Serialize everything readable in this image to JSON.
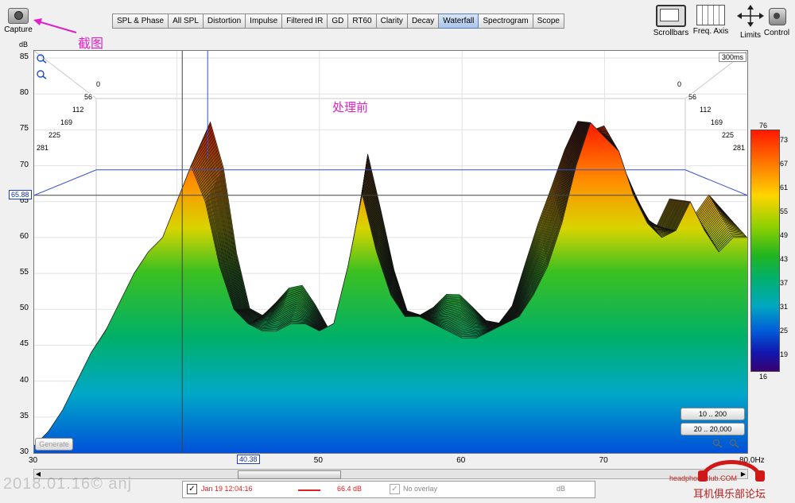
{
  "toolbar": {
    "capture_label": "Capture",
    "annotation": "截图",
    "tabs": [
      "SPL & Phase",
      "All SPL",
      "Distortion",
      "Impulse",
      "Filtered IR",
      "GD",
      "RT60",
      "Clarity",
      "Decay",
      "Waterfall",
      "Spectrogram",
      "Scope"
    ],
    "active_tab": "Waterfall",
    "right_tools": [
      {
        "label": "Scrollbars",
        "icon": "scrollbars-icon"
      },
      {
        "label": "Freq. Axis",
        "icon": "freq-axis-icon"
      },
      {
        "label": "Limits",
        "icon": "limits-icon"
      },
      {
        "label": "Control",
        "icon": "control-icon"
      }
    ]
  },
  "plot": {
    "y_unit": "dB",
    "time_range_label": "300ms",
    "title_overlay": "处理前",
    "cursor_y": "65.88",
    "cursor_x": "40.38",
    "generate_label": "Generate",
    "range_buttons": [
      "10 .. 200",
      "20 .. 20,000"
    ],
    "time_labels": [
      "0",
      "56",
      "112",
      "169",
      "225",
      "281"
    ]
  },
  "chart_data": {
    "type": "area",
    "title": "处理前",
    "xlabel": "",
    "ylabel": "dB",
    "xlim": [
      30,
      80
    ],
    "ylim": [
      30,
      86
    ],
    "x_ticks": [
      "30",
      "40.38",
      "50",
      "60",
      "70",
      "80.0Hz"
    ],
    "y_ticks": [
      "30",
      "35",
      "40",
      "45",
      "50",
      "55",
      "60",
      "65",
      "70",
      "75",
      "80",
      "85"
    ],
    "series": [
      {
        "name": "Jan 19 12:04:16",
        "x": [
          30,
          31,
          32,
          33,
          34,
          35,
          36,
          37,
          38,
          39,
          40,
          41,
          42,
          43,
          44,
          45,
          46,
          47,
          48,
          49,
          50,
          51,
          52,
          53,
          54,
          55,
          56,
          57,
          58,
          59,
          60,
          61,
          62,
          63,
          64,
          65,
          66,
          67,
          68,
          69,
          70,
          71,
          72,
          73,
          74,
          75,
          76,
          77,
          78,
          79,
          80
        ],
        "y": [
          31,
          33,
          36,
          40,
          44,
          47,
          51,
          55,
          58,
          60,
          65,
          70,
          65,
          56,
          50,
          48,
          47,
          47,
          48,
          48,
          47,
          48,
          56,
          66,
          58,
          52,
          49,
          49,
          48,
          47,
          46,
          46,
          47,
          48,
          49,
          52,
          56,
          62,
          70,
          76,
          74,
          72,
          66,
          62,
          60,
          61,
          65,
          61,
          58,
          60,
          60
        ]
      }
    ],
    "color_scale": {
      "max": "76",
      "min": "16",
      "ticks": [
        "73",
        "67",
        "61",
        "55",
        "49",
        "43",
        "37",
        "31",
        "25",
        "19"
      ]
    }
  },
  "legend": {
    "name": "Jan 19 12:04:16",
    "value": "66.4 dB",
    "overlay": "No overlay",
    "unit": "dB"
  },
  "watermark": "2018.01.16© anj",
  "branding": {
    "url": "headphoneclub.COM",
    "name": "耳机俱乐部论坛"
  }
}
